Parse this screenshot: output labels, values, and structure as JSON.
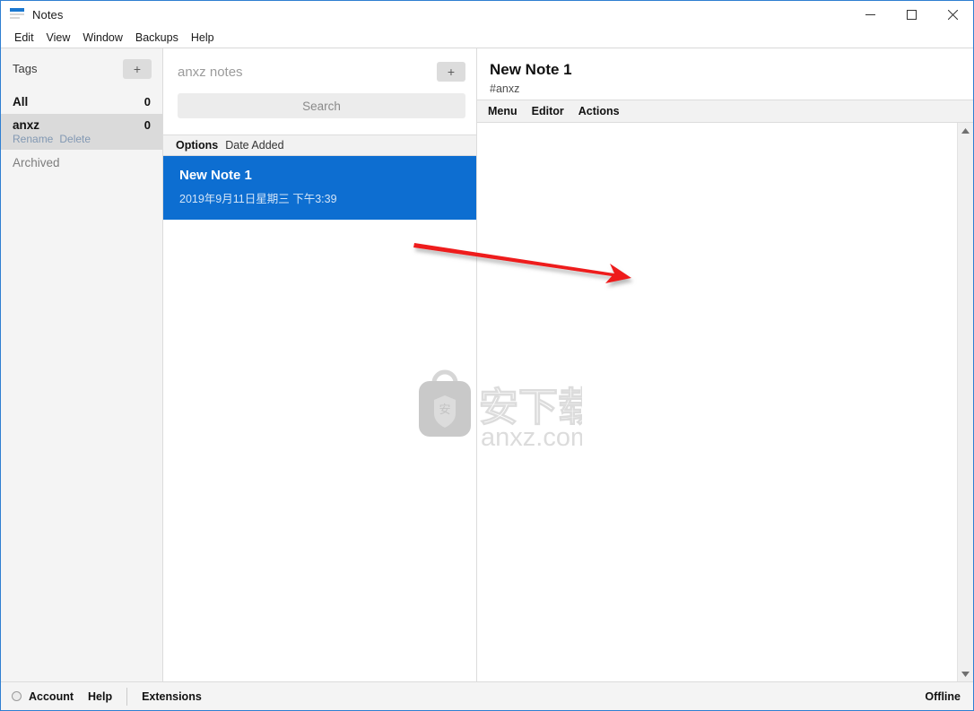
{
  "window": {
    "title": "Notes",
    "logo_icon": "notes-logo-icon",
    "controls": {
      "minimize": "minimize-icon",
      "maximize": "maximize-icon",
      "close": "close-icon"
    }
  },
  "menubar": {
    "items": [
      {
        "label": "Edit"
      },
      {
        "label": "View"
      },
      {
        "label": "Window"
      },
      {
        "label": "Backups"
      },
      {
        "label": "Help"
      }
    ]
  },
  "sidebar": {
    "header": {
      "title": "Tags",
      "add_label": "+"
    },
    "tags": [
      {
        "name": "All",
        "count": "0",
        "selected": false,
        "actions": []
      },
      {
        "name": "anxz",
        "count": "0",
        "selected": true,
        "actions": [
          "Rename",
          "Delete"
        ]
      }
    ],
    "archived": {
      "name": "Archived"
    }
  },
  "notes_panel": {
    "title": "anxz notes",
    "add_label": "+",
    "search_placeholder": "Search",
    "options_bar": {
      "options_label": "Options",
      "sort_label": "Date Added"
    },
    "notes": [
      {
        "title": "New Note 1",
        "date": "2019年9月11日星期三 下午3:39",
        "selected": true
      }
    ]
  },
  "editor": {
    "title": "New Note 1",
    "tag": "#anxz",
    "toolbar": [
      {
        "label": "Menu"
      },
      {
        "label": "Editor"
      },
      {
        "label": "Actions"
      }
    ],
    "content": "",
    "scrollbar": {
      "up": "scroll-up-arrow-icon",
      "down": "scroll-down-arrow-icon"
    }
  },
  "watermark": {
    "text": "anxz.com",
    "cn_text": "安下载",
    "logo_char": "安"
  },
  "statusbar": {
    "account_label": "Account",
    "help_label": "Help",
    "extensions_label": "Extensions",
    "connection_status": "Offline"
  },
  "colors": {
    "accent_blue": "#0d6ed1",
    "window_border": "#2f7fd1",
    "sidebar_bg": "#f4f4f4",
    "selected_tag_bg": "#dadada",
    "annotation_red": "#ee1c1c"
  }
}
